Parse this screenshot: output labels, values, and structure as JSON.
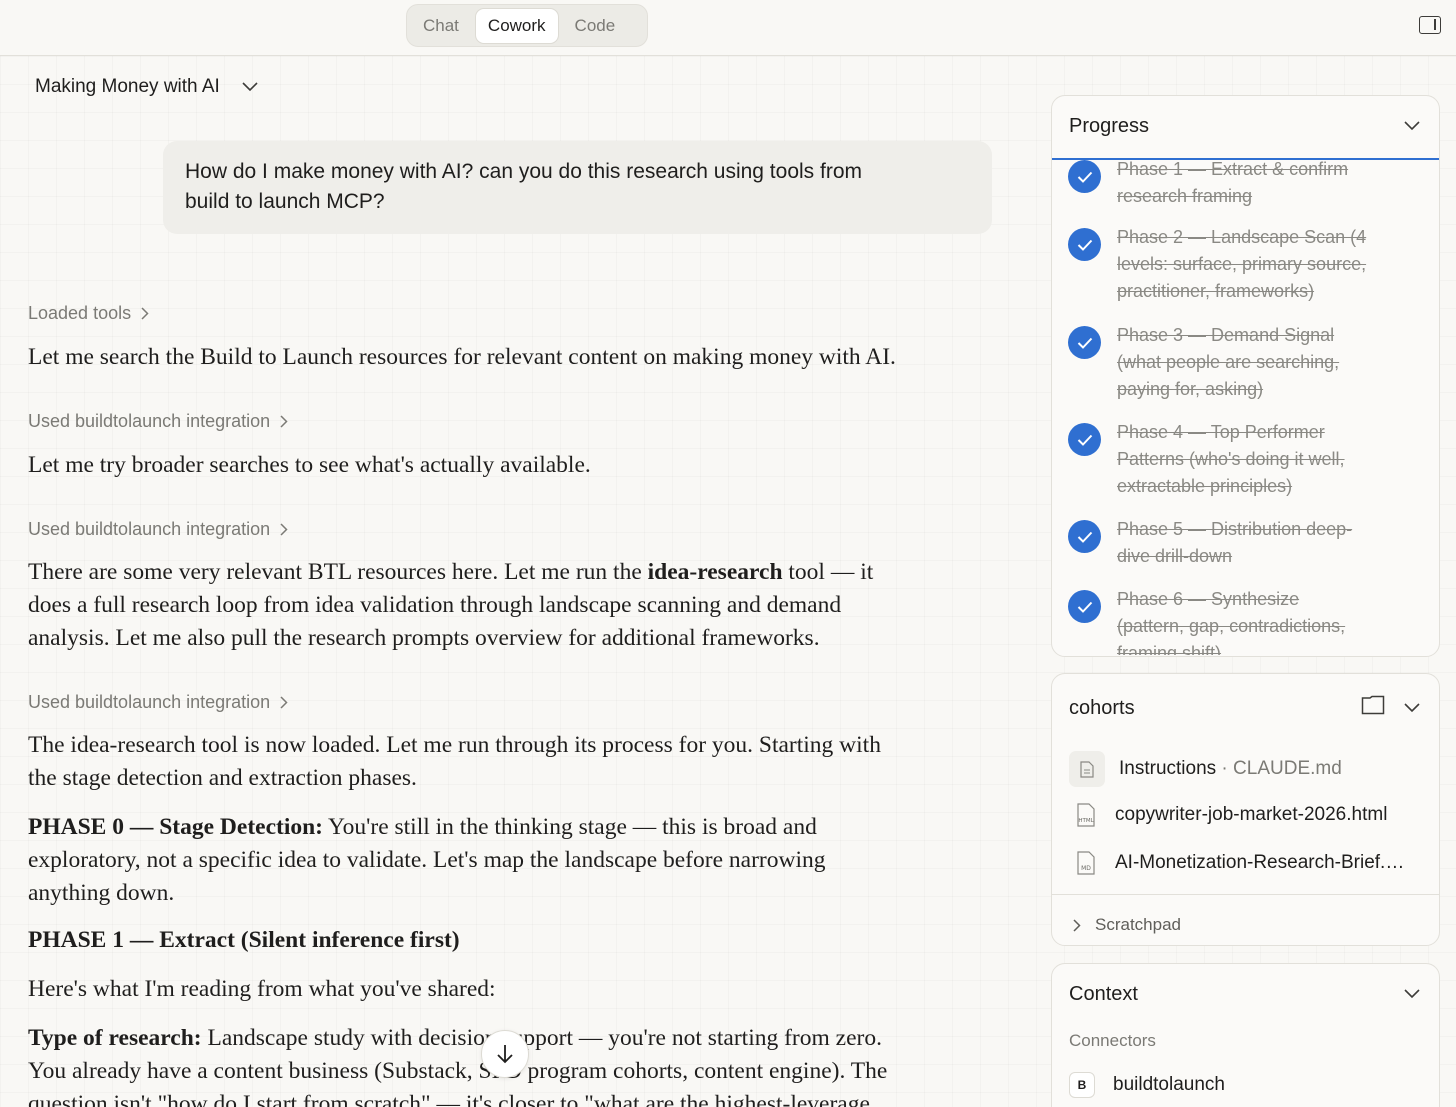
{
  "modes": {
    "chat": "Chat",
    "cowork": "Cowork",
    "code": "Code",
    "active": "Cowork"
  },
  "project": {
    "title": "Making Money with AI"
  },
  "user_message": {
    "line1": "How do I make money with AI? can you do this research using tools from",
    "line2": "build to launch MCP?"
  },
  "conversation": {
    "loaded_tools": "Loaded tools",
    "msg1": "Let me search the Build to Launch resources for relevant content on making money with AI.",
    "used_integration_1": "Used buildtolaunch integration",
    "msg2": "Let me try broader searches to see what's actually available.",
    "used_integration_2": "Used buildtolaunch integration",
    "msg3_before": "There are some very relevant BTL resources here. Let me run the ",
    "msg3_bold": "idea-research",
    "msg3_after_1": " tool — it",
    "msg3_line2": "does a full research loop from idea validation through landscape scanning and demand",
    "msg3_line3": "analysis. Let me also pull the research prompts overview for additional frameworks.",
    "used_integration_3": "Used buildtolaunch integration",
    "msg4_line1": "The idea-research tool is now loaded. Let me run through its process for you. Starting with",
    "msg4_line2": "the stage detection and extraction phases.",
    "phase0_bold": "PHASE 0 — Stage Detection:",
    "phase0_line1": " You're still in the thinking stage — this is broad and",
    "phase0_line2": "exploratory, not a specific idea to validate. Let's map the landscape before narrowing",
    "phase0_line3": "anything down.",
    "phase1_heading": "PHASE 1 — Extract (Silent inference first)",
    "reading_line": "Here's what I'm reading from what you've shared:",
    "type_bold": "Type of research:",
    "type_line1": " Landscape study with decision support — you're not starting from zero.",
    "type_line2": "You already have a content business (Substack, SPD program cohorts, content engine). The",
    "type_line3": "question isn't \"how do I start from scratch\" — it's closer to \"what are the highest-leverage"
  },
  "progress": {
    "title": "Progress",
    "phases": [
      {
        "line1": "Phase 1 — Extract & confirm",
        "line2": "research framing",
        "line3": ""
      },
      {
        "line1": "Phase 2 — Landscape Scan (4",
        "line2": "levels: surface, primary source,",
        "line3": "practitioner, frameworks)"
      },
      {
        "line1": "Phase 3 — Demand Signal",
        "line2": "(what people are searching,",
        "line3": "paying for, asking)"
      },
      {
        "line1": "Phase 4 — Top Performer",
        "line2": "Patterns (who's doing it well,",
        "line3": "extractable principles)"
      },
      {
        "line1": "Phase 5 — Distribution deep-",
        "line2": "dive drill-down",
        "line3": ""
      },
      {
        "line1": "Phase 6 — Synthesize",
        "line2": "(pattern, gap, contradictions,",
        "line3": "framing shift)"
      }
    ]
  },
  "cohorts": {
    "title": "cohorts",
    "files": [
      {
        "name": "Instructions",
        "sep": " · ",
        "detail": "CLAUDE.md",
        "icon": "doc-icon"
      },
      {
        "name": "copywriter-job-market-2026.html",
        "icon": "html-file-icon",
        "badge": "HTML"
      },
      {
        "name": "AI-Monetization-Research-Brief.…",
        "icon": "md-file-icon",
        "badge": "MD"
      }
    ],
    "scratchpad": "Scratchpad"
  },
  "context": {
    "title": "Context",
    "connectors_label": "Connectors",
    "connector_letter": "B",
    "connector_name": "buildtolaunch"
  },
  "colors": {
    "accent": "#2f6fd1",
    "background": "#f9f8f5",
    "muted_text": "#7b7a75"
  }
}
